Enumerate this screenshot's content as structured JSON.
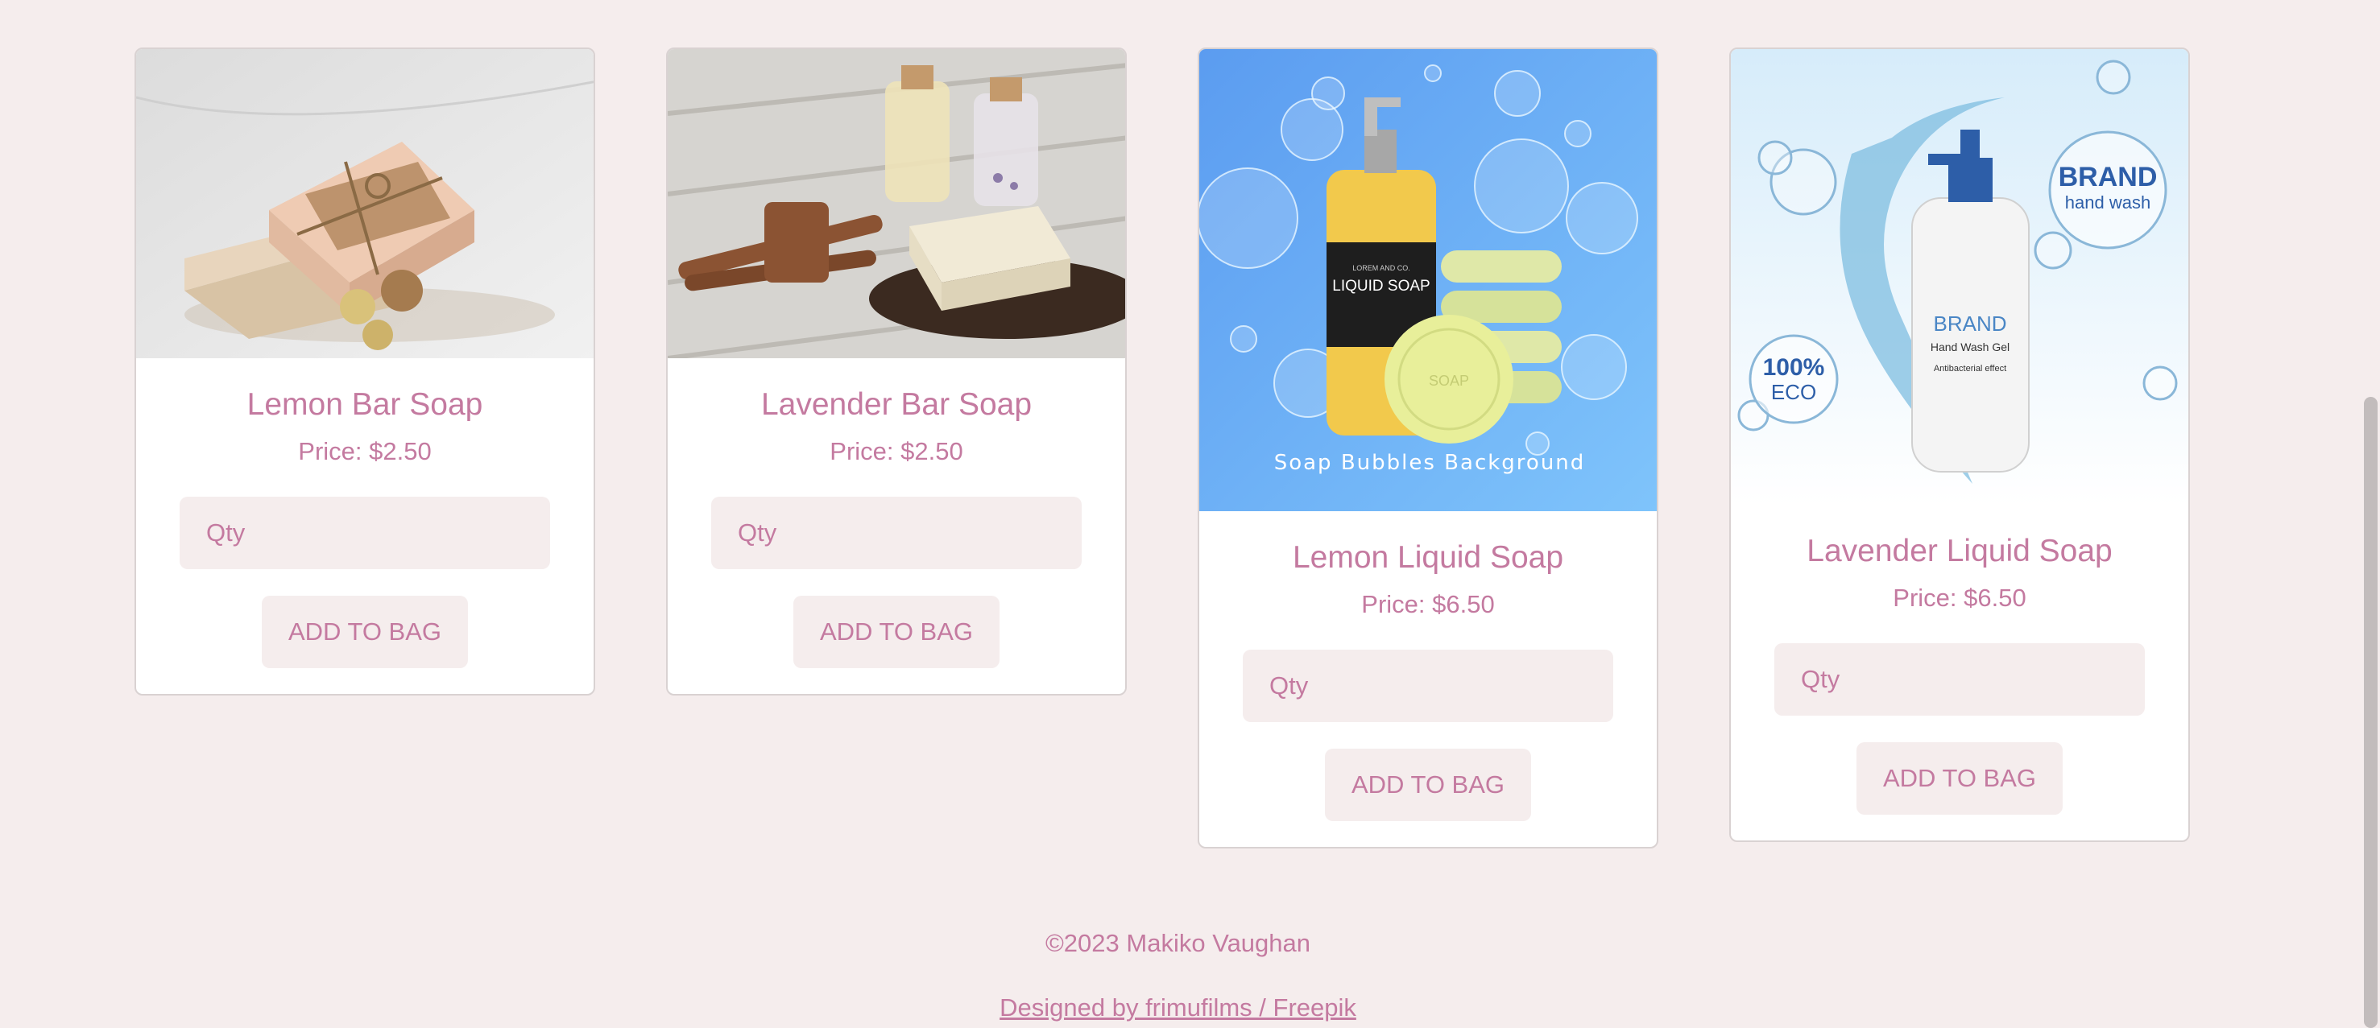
{
  "products": [
    {
      "name": "Lemon Bar Soap",
      "price": "Price: $2.50",
      "qty_placeholder": "Qty",
      "button": "ADD TO BAG",
      "image": "lemon-bar-soap-photo"
    },
    {
      "name": "Lavender Bar Soap",
      "price": "Price: $2.50",
      "qty_placeholder": "Qty",
      "button": "ADD TO BAG",
      "image": "lavender-bar-soap-photo"
    },
    {
      "name": "Lemon Liquid Soap",
      "price": "Price: $6.50",
      "qty_placeholder": "Qty",
      "button": "ADD TO BAG",
      "image": "lemon-liquid-soap-illustration",
      "image_caption": "Soap Bubbles Background",
      "label_text": [
        "LOREM AND CO.",
        "LIQUID SOAP",
        "SOAP"
      ]
    },
    {
      "name": "Lavender Liquid Soap",
      "price": "Price: $6.50",
      "qty_placeholder": "Qty",
      "button": "ADD TO BAG",
      "image": "lavender-liquid-soap-illustration",
      "label_text": [
        "BRAND",
        "hand wash",
        "100%",
        "ECO",
        "BRAND",
        "Hand Wash Gel",
        "Antibacterial effect"
      ]
    }
  ],
  "footer": {
    "copyright": "©2023 Makiko Vaughan",
    "credit_link": "Designed by frimufilms / Freepik"
  },
  "colors": {
    "accent": "#c47aa0",
    "background": "#f5eded",
    "card": "#ffffff"
  }
}
